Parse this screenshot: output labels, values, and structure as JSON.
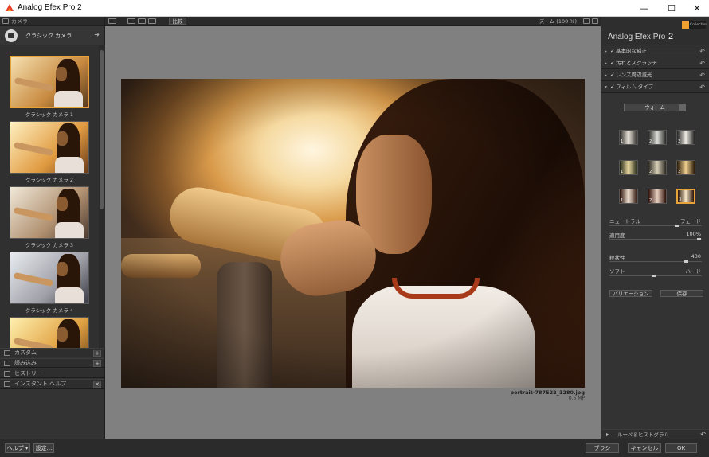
{
  "window": {
    "title": "Analog Efex Pro 2",
    "minimize": "—",
    "maximize": "☐",
    "close": "✕"
  },
  "left_panel": {
    "header": "カメラ",
    "category": "クラシック カメラ",
    "thumbnails": [
      {
        "label": "クラシック カメラ 1"
      },
      {
        "label": "クラシック カメラ 2"
      },
      {
        "label": "クラシック カメラ 3"
      },
      {
        "label": "クラシック カメラ 4"
      },
      {
        "label": ""
      }
    ],
    "sections": [
      "カスタム",
      "読み込み",
      "ヒストリー",
      "インスタント ヘルプ"
    ]
  },
  "toolbar": {
    "compare_label": "比較",
    "zoom_label": "ズーム (100 %)"
  },
  "canvas": {
    "file_name": "portrait-787522_1280.jpg",
    "file_size": "0.5 MP"
  },
  "right_panel": {
    "brand_name": "Analog Efex Pro",
    "brand_version": "2",
    "badge": "Collection",
    "filters": [
      {
        "label": "基本的な補正",
        "expanded": false
      },
      {
        "label": "汚れとスクラッチ",
        "expanded": false
      },
      {
        "label": "レンズ周辺減光",
        "expanded": false
      },
      {
        "label": "フィルム タイプ",
        "expanded": true
      }
    ],
    "film_dropdown": "ウォーム",
    "swatches": [
      {
        "n": "1",
        "from": "#e8e2d8",
        "to": "#2c2a28"
      },
      {
        "n": "2",
        "from": "#dcdcd8",
        "to": "#282826"
      },
      {
        "n": "3",
        "from": "#f0ece4",
        "to": "#222"
      },
      {
        "n": "1",
        "from": "#e8d8a0",
        "to": "#1e2412"
      },
      {
        "n": "2",
        "from": "#d8d0b8",
        "to": "#2a2820"
      },
      {
        "n": "3",
        "from": "#f0d090",
        "to": "#2a1a08"
      },
      {
        "n": "1",
        "from": "#f0e0d0",
        "to": "#2a1008"
      },
      {
        "n": "2",
        "from": "#e8d0c0",
        "to": "#301008"
      },
      {
        "n": "3",
        "from": "#f8e8c8",
        "to": "#281408"
      }
    ],
    "sliders": {
      "neutral_label": "ニュートラル",
      "fade_label": "フェード",
      "strength_label": "適用度",
      "strength_value": "100%",
      "grain_label": "粒状性",
      "grain_value": "430",
      "soft_label": "ソフト",
      "hard_label": "ハード"
    },
    "variation_button": "バリエーション",
    "save_button": "保存",
    "loupe_label": "ルーペ＆ヒストグラム"
  },
  "bottom_bar": {
    "help_label": "ヘルプ",
    "settings_label": "設定...",
    "brush_label": "ブラシ",
    "cancel_label": "キャンセル",
    "ok_label": "OK"
  }
}
